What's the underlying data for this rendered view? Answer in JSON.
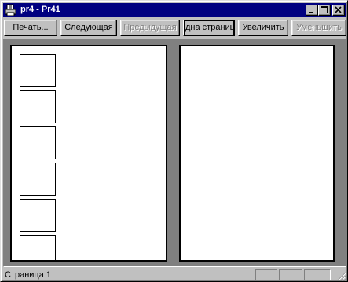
{
  "window": {
    "title": "pr4 - Pr41",
    "app_icon": "printer-icon",
    "controls": [
      "minimize-icon",
      "maximize-icon",
      "close-icon"
    ]
  },
  "toolbar": {
    "print": {
      "label_underlined": "П",
      "label_rest": "ечать..."
    },
    "next": {
      "label_underlined": "С",
      "label_rest": "ледующая"
    },
    "prev": {
      "label": "Предыдущая",
      "enabled": false
    },
    "one_page": {
      "label": "дна страниц"
    },
    "zoom_in": {
      "label_underlined": "У",
      "label_rest": "величить"
    },
    "zoom_out": {
      "label": "Уменьшить",
      "enabled": false
    }
  },
  "preview": {
    "left_page_cell_count": 6,
    "right_page_cell_count": 0
  },
  "status": {
    "text": "Страница 1"
  },
  "colors": {
    "titlebar": "#000080",
    "face": "#c0c0c0",
    "preview_bg": "#808080",
    "page": "#ffffff"
  }
}
